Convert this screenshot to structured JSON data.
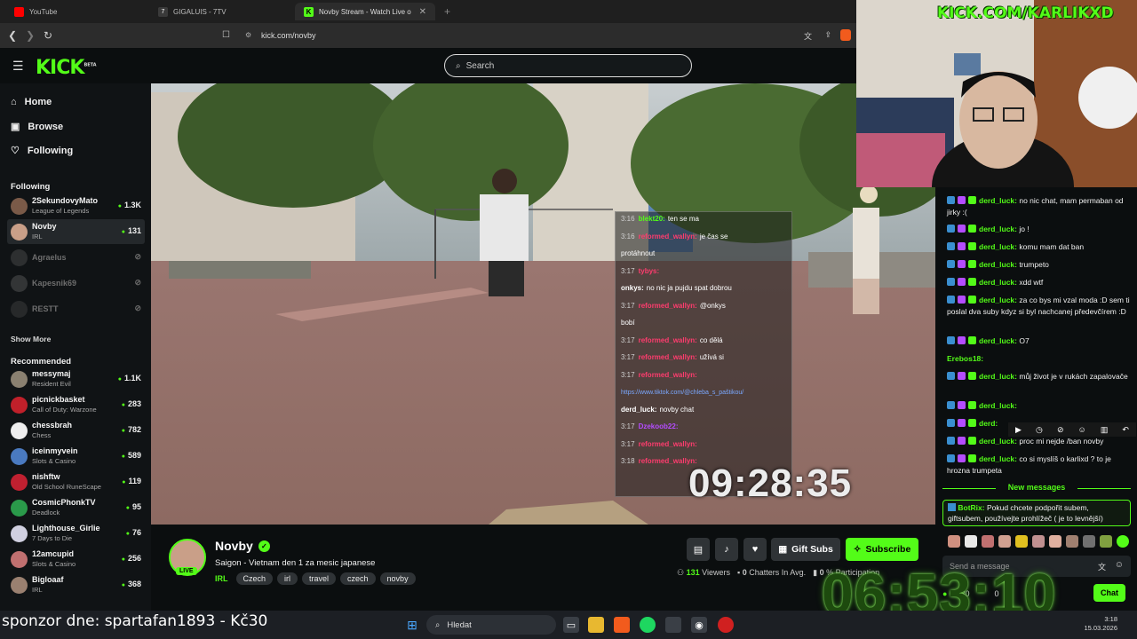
{
  "browser": {
    "tabs": [
      {
        "title": "YouTube",
        "color": "#ff0000"
      },
      {
        "title": "GIGALUIS - 7TV",
        "color": "#1f1f1f"
      },
      {
        "title": "Novby Stream - Watch Live o",
        "color": "#53fc18"
      }
    ],
    "url": "kick.com/novby"
  },
  "header": {
    "logo": "KICK",
    "logo_beta": "BETA",
    "search_placeholder": "Search"
  },
  "sidebar": {
    "nav": [
      {
        "label": "Home",
        "icon": "home-icon"
      },
      {
        "label": "Browse",
        "icon": "browse-icon"
      },
      {
        "label": "Following",
        "icon": "heart-icon"
      }
    ],
    "following_title": "Following",
    "following": [
      {
        "name": "2SekundovyMato",
        "game": "League of Legends",
        "viewers": "1.3K",
        "color": "#7a5a48"
      },
      {
        "name": "Novby",
        "game": "IRL",
        "viewers": "131",
        "color": "#c99f88"
      },
      {
        "name": "Agraelus",
        "game": "",
        "viewers": "",
        "color": "#5a5a5a"
      },
      {
        "name": "Kapesnik69",
        "game": "",
        "viewers": "",
        "color": "#6a6a6a"
      },
      {
        "name": "RESTT",
        "game": "",
        "viewers": "",
        "color": "#4a4a4a"
      }
    ],
    "show_more": "Show More",
    "recommended_title": "Recommended",
    "recommended": [
      {
        "name": "messymaj",
        "game": "Resident Evil",
        "viewers": "1.1K",
        "color": "#8a8070"
      },
      {
        "name": "picnickbasket",
        "game": "Call of Duty: Warzone",
        "viewers": "283",
        "color": "#c0202a"
      },
      {
        "name": "chessbrah",
        "game": "Chess",
        "viewers": "782",
        "color": "#eeeeee"
      },
      {
        "name": "iceinmyvein",
        "game": "Slots & Casino",
        "viewers": "589",
        "color": "#4a7ac0"
      },
      {
        "name": "nishftw",
        "game": "Old School RuneScape",
        "viewers": "119",
        "color": "#c02030"
      },
      {
        "name": "CosmicPhonkTV",
        "game": "Deadlock",
        "viewers": "95",
        "color": "#2a9a4a"
      },
      {
        "name": "Lighthouse_Girlie",
        "game": "7 Days to Die",
        "viewers": "76",
        "color": "#d0d0e0"
      },
      {
        "name": "12amcupid",
        "game": "Slots & Casino",
        "viewers": "256",
        "color": "#c07070"
      },
      {
        "name": "Bigloaaf",
        "game": "IRL",
        "viewers": "368",
        "color": "#9a8070"
      }
    ]
  },
  "overlay_chat": [
    {
      "time": "3:16",
      "user": "blekt20:",
      "text": "ten se ma",
      "ucolor": "#53fc18"
    },
    {
      "time": "3:16",
      "user": "reformed_wallyn:",
      "text": "je čas se",
      "ucolor": "#ff3c6e"
    },
    {
      "time": "",
      "user": "",
      "text": "protáhnout",
      "ucolor": "#ff3c6e"
    },
    {
      "time": "3:17",
      "user": "tybys:",
      "text": "",
      "ucolor": "#ff3c6e"
    },
    {
      "time": "",
      "user": "onkys:",
      "text": "no nic ja pujdu spat dobrou",
      "ucolor": "#ffffff"
    },
    {
      "time": "3:17",
      "user": "reformed_wallyn:",
      "text": "@onkys",
      "ucolor": "#ff3c6e"
    },
    {
      "time": "",
      "user": "",
      "text": "bobí",
      "ucolor": "#ff3c6e"
    },
    {
      "time": "3:17",
      "user": "reformed_wallyn:",
      "text": "co dělá",
      "ucolor": "#ff3c6e"
    },
    {
      "time": "3:17",
      "user": "reformed_wallyn:",
      "text": "užívá si",
      "ucolor": "#ff3c6e"
    },
    {
      "time": "3:17",
      "user": "reformed_wallyn:",
      "text": "",
      "ucolor": "#ff3c6e"
    },
    {
      "time": "",
      "user": "",
      "text": "https://www.tiktok.com/@chleba_s_paštikou/",
      "ucolor": "#7aa8ff"
    },
    {
      "time": "",
      "user": "derd_luck:",
      "text": "novby chat",
      "ucolor": "#ffffff"
    },
    {
      "time": "3:17",
      "user": "Dzekoob22:",
      "text": "",
      "ucolor": "#b44cff"
    },
    {
      "time": "3:17",
      "user": "reformed_wallyn:",
      "text": "",
      "ucolor": "#ff3c6e"
    },
    {
      "time": "3:18",
      "user": "reformed_wallyn:",
      "text": "",
      "ucolor": "#ff3c6e"
    }
  ],
  "video_clock": "09:28:35",
  "stream": {
    "name": "Novby",
    "live": "LIVE",
    "title": "Saigon - Vietnam den 1 za mesic japanese",
    "category": "IRL",
    "tags": [
      "Czech",
      "irl",
      "travel",
      "czech",
      "novby"
    ],
    "gift_subs": "Gift Subs",
    "subscribe": "Subscribe",
    "viewers": "131",
    "viewers_label": "Viewers",
    "chatters": "0",
    "chatters_label": "Chatters In Avg.",
    "participation": "0",
    "participation_label": "% Participation"
  },
  "webcam": {
    "banner": "KICK.COM/KARLIKXD"
  },
  "chat": {
    "messages": [
      {
        "user": "derd_luck",
        "text": "no nic chat, mam permaban od jirky :("
      },
      {
        "user": "derd_luck",
        "text": "jo !"
      },
      {
        "user": "derd_luck",
        "text": "komu mam dat ban"
      },
      {
        "user": "derd_luck",
        "text": "trumpeto"
      },
      {
        "user": "derd_luck",
        "text": "xdd wtf"
      },
      {
        "user": "derd_luck",
        "text": "za co bys mi vzal moda :D sem ti poslal dva suby kdyz si byl nachcanej předevčírem :D"
      },
      {
        "user": "derd_luck",
        "text": "O7"
      },
      {
        "user": "Erebos18",
        "text": ""
      },
      {
        "user": "derd_luck",
        "text": "můj život je v rukách zapalovače"
      },
      {
        "user": "derd_luck",
        "text": ""
      },
      {
        "user": "derd",
        "text": ""
      },
      {
        "user": "derd_luck",
        "text": "proc mi nejde /ban novby"
      },
      {
        "user": "derd_luck",
        "text": "co si myslíš o karlixd ? to je hrozna trumpeta"
      }
    ],
    "new_messages": "New messages",
    "pinned_user": "BotRix",
    "pinned_text": "Pokud chcete podpořit subem, giftsubem, používejte prohlížeč ( je to levnější)",
    "input_placeholder": "Send a message",
    "points": "430",
    "count": "0",
    "send": "Chat"
  },
  "big_clock": "06:53:10",
  "taskbar": {
    "sponsor": "sponzor dne: spartafan1893 - Kč30",
    "search": "Hledat",
    "time": "3:18",
    "date": "15.03.2026"
  }
}
